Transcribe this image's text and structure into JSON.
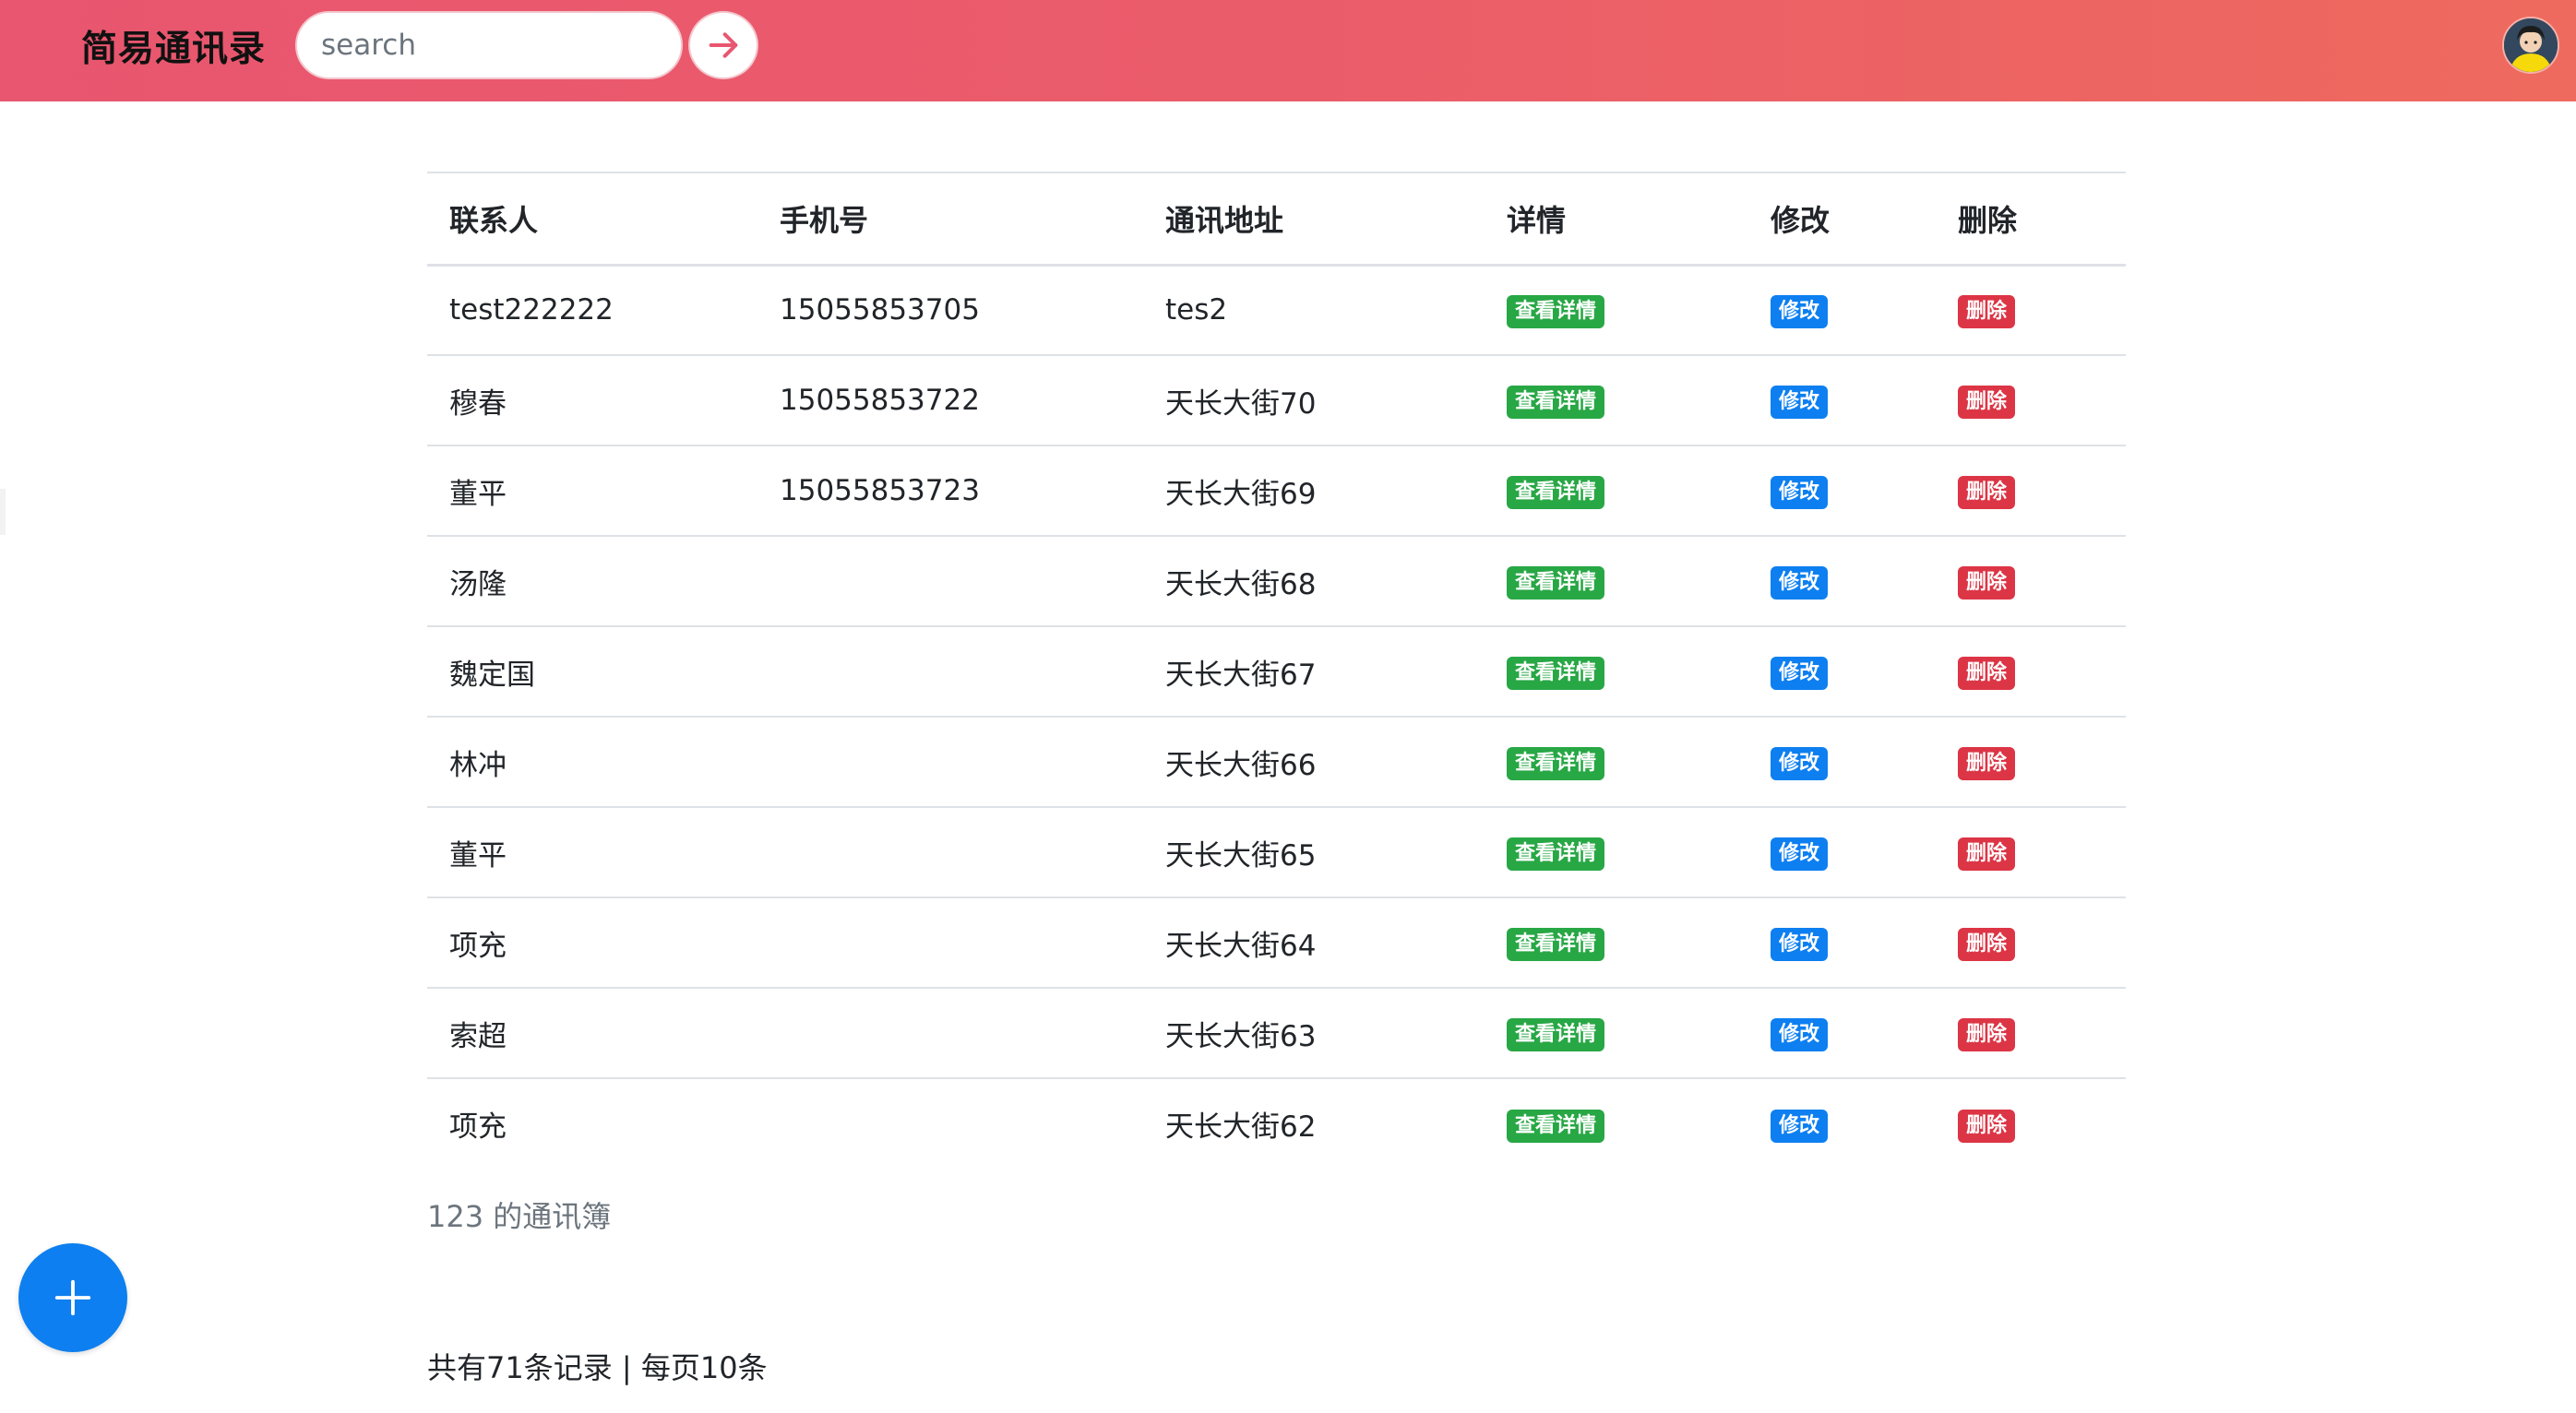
{
  "app": {
    "title": "简易通讯录"
  },
  "search": {
    "placeholder": "search"
  },
  "table": {
    "headers": [
      "联系人",
      "手机号",
      "通讯地址",
      "详情",
      "修改",
      "删除"
    ],
    "action_labels": {
      "detail": "查看详情",
      "edit": "修改",
      "delete": "删除"
    },
    "rows": [
      {
        "name": "test222222",
        "phone": "15055853705",
        "address": "tes2"
      },
      {
        "name": "穆春",
        "phone": "15055853722",
        "address": "天长大街70"
      },
      {
        "name": "董平",
        "phone": "15055853723",
        "address": "天长大街69"
      },
      {
        "name": "汤隆",
        "phone": "",
        "address": "天长大街68"
      },
      {
        "name": "魏定国",
        "phone": "",
        "address": "天长大街67"
      },
      {
        "name": "林冲",
        "phone": "",
        "address": "天长大街66"
      },
      {
        "name": "董平",
        "phone": "",
        "address": "天长大街65"
      },
      {
        "name": "项充",
        "phone": "",
        "address": "天长大街64"
      },
      {
        "name": "索超",
        "phone": "",
        "address": "天长大街63"
      },
      {
        "name": "项充",
        "phone": "",
        "address": "天长大街62"
      }
    ]
  },
  "footer": {
    "book_title": "123 的通讯簿",
    "record_summary": "共有71条记录 | 每页10条"
  },
  "icons": {
    "search_button": "arrow-right-icon",
    "fab": "plus-icon",
    "avatar": "user-avatar"
  },
  "colors": {
    "header_gradient_start": "#e8566f",
    "header_gradient_end": "#ee6a5e",
    "detail_badge": "#28a745",
    "edit_badge": "#0d7ff0",
    "delete_badge": "#dc3545",
    "fab": "#0d7ff0"
  }
}
